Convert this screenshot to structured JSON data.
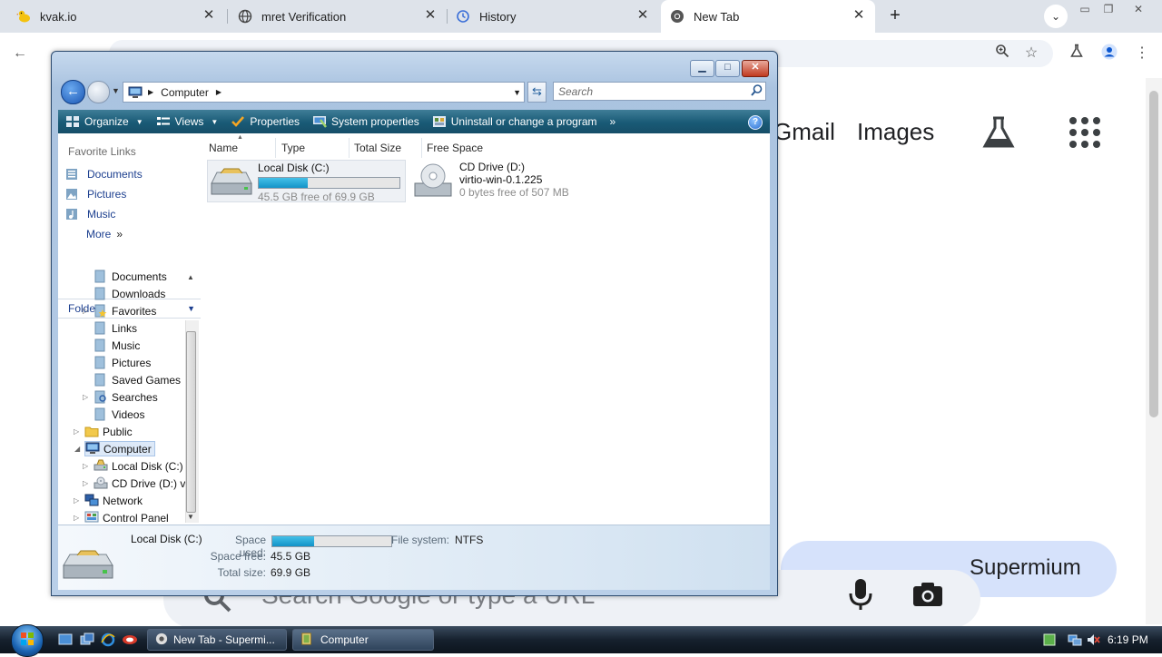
{
  "browser": {
    "tabs": [
      {
        "label": "kvak.io",
        "icon": "duck-icon"
      },
      {
        "label": "mret Verification",
        "icon": "globe-icon"
      },
      {
        "label": "History",
        "icon": "history-icon"
      },
      {
        "label": "New Tab",
        "icon": "chromium-icon",
        "active": true
      }
    ],
    "omnibox_partial": "Search Google or type a URL",
    "ntp": {
      "links": [
        "Gmail",
        "Images"
      ],
      "search_placeholder": "Search Google or type a URL",
      "customize_label": "Supermium"
    }
  },
  "explorer": {
    "address": {
      "segments": [
        "Computer"
      ]
    },
    "search_placeholder": "Search",
    "commands": [
      {
        "label": "Organize",
        "has_menu": true
      },
      {
        "label": "Views",
        "has_menu": true
      },
      {
        "label": "Properties"
      },
      {
        "label": "System properties"
      },
      {
        "label": "Uninstall or change a program"
      }
    ],
    "more_chevron": "»",
    "help": "?",
    "favorite_links_title": "Favorite Links",
    "favorite_links": [
      "Documents",
      "Pictures",
      "Music"
    ],
    "more_label": "More",
    "folders_label": "Folders",
    "tree": [
      "Documents",
      "Downloads",
      "Favorites",
      "Links",
      "Music",
      "Pictures",
      "Saved Games",
      "Searches",
      "Videos",
      "Public",
      "Computer",
      "Local Disk (C:)",
      "CD Drive (D:) v",
      "Network",
      "Control Panel"
    ],
    "columns": [
      "Name",
      "Type",
      "Total Size",
      "Free Space"
    ],
    "drives": [
      {
        "name": "Local Disk (C:)",
        "free_text": "45.5 GB free of 69.9 GB",
        "used_fraction": 0.35
      },
      {
        "name": "CD Drive (D:)",
        "label": "virtio-win-0.1.225",
        "free_text": "0 bytes free of 507 MB"
      }
    ],
    "details": {
      "name": "Local Disk (C:)",
      "space_used_label": "Space used:",
      "used_fraction": 0.35,
      "file_system_label": "File system:",
      "file_system": "NTFS",
      "space_free_label": "Space free:",
      "space_free": "45.5 GB",
      "total_size_label": "Total size:",
      "total_size": "69.9 GB"
    }
  },
  "taskbar": {
    "buttons": [
      "New Tab - Supermi...",
      "Computer"
    ],
    "clock": "6:19 PM"
  }
}
